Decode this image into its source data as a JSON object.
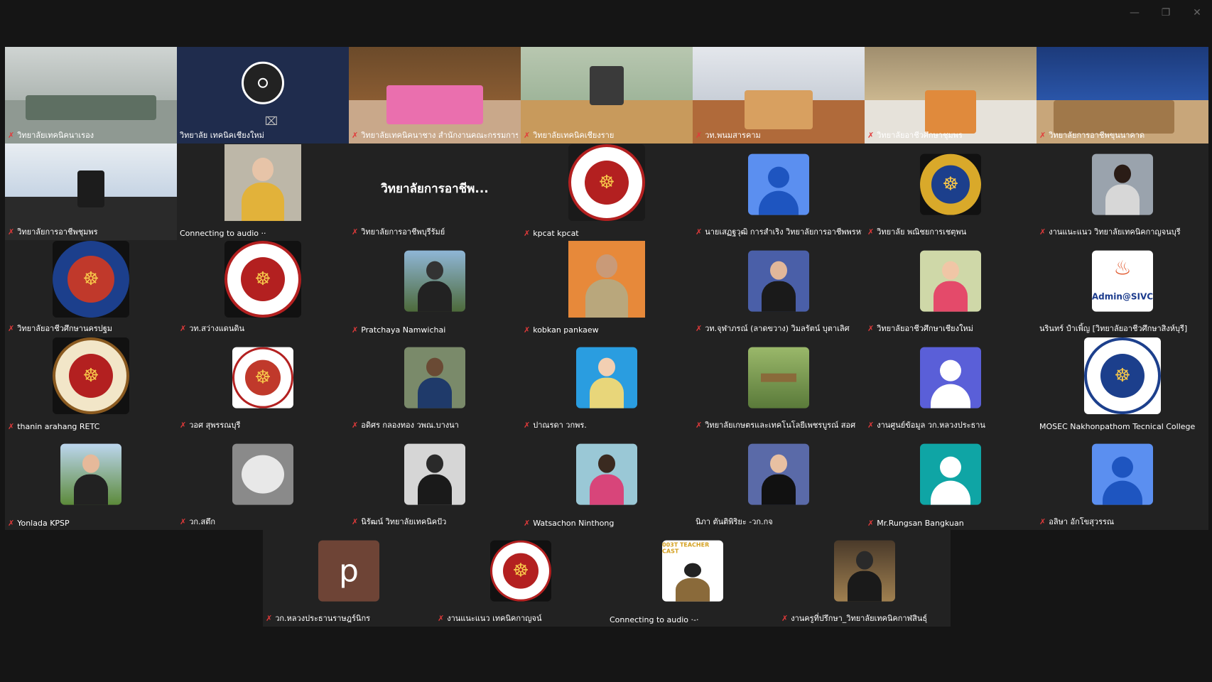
{
  "window": {
    "minimize": "—",
    "restore": "❐",
    "close": "✕"
  },
  "colors": {
    "background": "#151515",
    "tile": "#222222",
    "active_border": "#4cc46a",
    "muted_mic": "#e23a3a"
  },
  "participants_row1": [
    {
      "name": "วิทยาลัยเทคนิคนาเรอง",
      "muted": true
    },
    {
      "name": "วิทยาลัย เทคนิคเชียงใหม่",
      "muted": false
    },
    {
      "name": "วิทยาลัยเทคนิคนาชาง สำนักงานคณะกรรมการกา...",
      "muted": true
    },
    {
      "name": "วิทยาลัยเทคนิคเชียงราย",
      "muted": true
    },
    {
      "name": "วท.พนมสารคาม",
      "muted": true
    },
    {
      "name": "วิทยาลัยอาชีวศึกษาชุมพร",
      "muted": true
    },
    {
      "name": "วิทยาลัยการอาชีพขุนนาคาด",
      "muted": true
    }
  ],
  "participants_row2": [
    {
      "name": "วิทยาลัยการอาชีพชุมพร",
      "muted": true
    },
    {
      "name": "Connecting to audio ··",
      "muted": false
    },
    {
      "name": "วิทยาลัยการอาชีพบุรีรัมย์",
      "muted": true,
      "display_text": "วิทยาลัยการอาชีพ..."
    },
    {
      "name": "kpcat kpcat",
      "muted": true
    },
    {
      "name": "นายเสฏฐวุฒิ การสำเริง วิทยาลัยการอาชีพพรหม...",
      "muted": true
    },
    {
      "name": "วิทยาลัย พณิชยการเชตุพน",
      "muted": true
    },
    {
      "name": "งานแนะแนว วิทยาลัยเทคนิคกาญจนบุรี",
      "muted": true
    }
  ],
  "participants_row3": [
    {
      "name": "วิทยาลัยอาชีวศึกษานครปฐม",
      "muted": true
    },
    {
      "name": "วท.สว่างแดนดิน",
      "muted": true
    },
    {
      "name": "Pratchaya Namwichai",
      "muted": true
    },
    {
      "name": "kobkan pankaew",
      "muted": true
    },
    {
      "name": "วท.จุฬาภรณ์ (ลาดขวาง) วิมลรัตน์ บุตาเลิศ",
      "muted": true
    },
    {
      "name": "วิทยาลัยอาชีวศึกษาเชียงใหม่",
      "muted": true
    },
    {
      "name": "นรินทร์ ปำเพิ้ญ [วิทยาลัยอาชีวศึกษาสิงห์บุรี]",
      "muted": false,
      "badge": "Admin@SIVC"
    }
  ],
  "participants_row4": [
    {
      "name": "thanin arahang RETC",
      "muted": true
    },
    {
      "name": "วอศ สุพรรณบุรี",
      "muted": true
    },
    {
      "name": "อดิศร กลองทอง วพณ.บางนา",
      "muted": true
    },
    {
      "name": "ปาณรดา วกพร.",
      "muted": true
    },
    {
      "name": "วิทยาลัยเกษตรและเทคโนโลยีเพชรบูรณ์ สอศ",
      "muted": true
    },
    {
      "name": "งานศูนย์ข้อมูล วก.หลวงประธาน",
      "muted": true
    },
    {
      "name": "MOSEC Nakhonpathom Tecnical College",
      "muted": false
    }
  ],
  "participants_row5": [
    {
      "name": "Yonlada KPSP",
      "muted": true
    },
    {
      "name": "วก.สตึก",
      "muted": true
    },
    {
      "name": "นิรัฒน์ วิทยาลัยเทคนิคปัว",
      "muted": true
    },
    {
      "name": "Watsachon Ninthong",
      "muted": true
    },
    {
      "name": "นิภา ตันติพิริยะ -วก.กจ",
      "muted": false
    },
    {
      "name": "Mr.Rungsan Bangkuan",
      "muted": true
    },
    {
      "name": "อลิษา อักโขสุวรรณ",
      "muted": true
    }
  ],
  "participants_row6": [
    {
      "name": "วก.หลวงประธานราษฎร์นิกร",
      "muted": true,
      "letter": "p"
    },
    {
      "name": "งานแนะแนว เทคนิคกาญจน์",
      "muted": true
    },
    {
      "name": "Connecting to audio ·-·",
      "muted": false,
      "banner": "003T TEACHER CAST"
    },
    {
      "name": "งานครูที่ปรึกษา_วิทยาลัยเทคนิคกาฬสินธุ์",
      "muted": true
    }
  ]
}
